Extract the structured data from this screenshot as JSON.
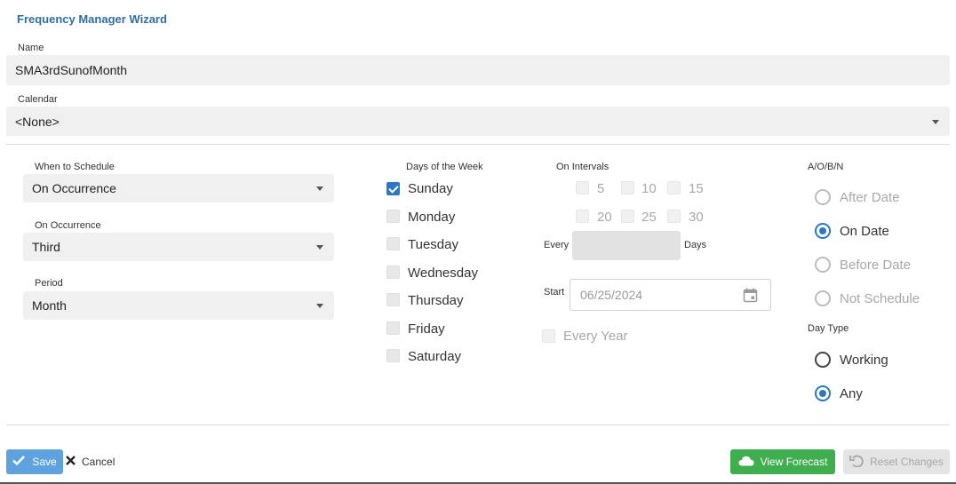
{
  "wizard": {
    "title": "Frequency Manager Wizard"
  },
  "name_field": {
    "label": "Name",
    "value": "SMA3rdSunofMonth"
  },
  "calendar_field": {
    "label": "Calendar",
    "value": "<None>"
  },
  "when_to_schedule": {
    "label": "When to Schedule",
    "value": "On Occurrence"
  },
  "on_occurrence": {
    "label": "On Occurrence",
    "value": "Third"
  },
  "period": {
    "label": "Period",
    "value": "Month"
  },
  "days_of_week": {
    "label": "Days of the Week",
    "items": [
      {
        "label": "Sunday",
        "checked": true
      },
      {
        "label": "Monday",
        "checked": false
      },
      {
        "label": "Tuesday",
        "checked": false
      },
      {
        "label": "Wednesday",
        "checked": false
      },
      {
        "label": "Thursday",
        "checked": false
      },
      {
        "label": "Friday",
        "checked": false
      },
      {
        "label": "Saturday",
        "checked": false
      }
    ]
  },
  "intervals": {
    "label": "On Intervals",
    "values": [
      "5",
      "10",
      "15",
      "20",
      "25",
      "30"
    ],
    "every_label": "Every",
    "days_label": "Days",
    "every_value": "",
    "start_label": "Start",
    "start_value": "06/25/2024",
    "every_year_label": "Every Year"
  },
  "aobn": {
    "label": "A/O/B/N",
    "options": [
      {
        "label": "After Date",
        "selected": false,
        "disabled": true
      },
      {
        "label": "On Date",
        "selected": true,
        "disabled": false
      },
      {
        "label": "Before Date",
        "selected": false,
        "disabled": true
      },
      {
        "label": "Not Schedule",
        "selected": false,
        "disabled": true
      }
    ]
  },
  "day_type": {
    "label": "Day Type",
    "options": [
      {
        "label": "Working",
        "selected": false
      },
      {
        "label": "Any",
        "selected": true
      }
    ]
  },
  "footer": {
    "save_label": "Save",
    "cancel_label": "Cancel",
    "forecast_label": "View Forecast",
    "reset_label": "Reset Changes"
  },
  "colors": {
    "accent": "#2b78c5",
    "title": "#2f6f9f",
    "save": "#5ea3dd",
    "forecast": "#3fae4f"
  }
}
